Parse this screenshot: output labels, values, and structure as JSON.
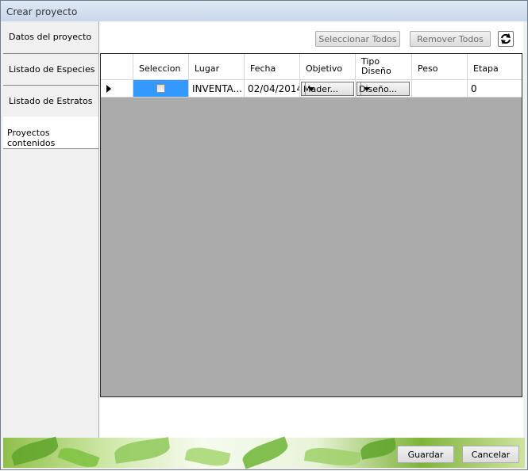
{
  "window": {
    "title": "Crear proyecto"
  },
  "sidebar": {
    "tabs": [
      {
        "label": "Datos del proyecto"
      },
      {
        "label": "Listado de Especies"
      },
      {
        "label": "Listado de Estratos"
      },
      {
        "label": "Proyectos contenidos"
      }
    ]
  },
  "toolbar": {
    "select_all_label": "Seleccionar Todos",
    "remove_all_label": "Remover Todos",
    "refresh_icon": "refresh-icon"
  },
  "grid": {
    "columns": [
      {
        "label": "Seleccion"
      },
      {
        "label": "Lugar"
      },
      {
        "label": "Fecha"
      },
      {
        "label": "Objetivo"
      },
      {
        "label": "Tipo Diseño"
      },
      {
        "label": "Peso"
      },
      {
        "label": "Etapa"
      }
    ],
    "rows": [
      {
        "seleccion": false,
        "lugar": "INVENTA...",
        "fecha": "02/04/2014",
        "objetivo": "Mader...",
        "tipo_diseno": "Diseño...",
        "peso": "",
        "etapa": "0"
      }
    ]
  },
  "footer": {
    "save_label": "Guardar",
    "cancel_label": "Cancelar"
  }
}
